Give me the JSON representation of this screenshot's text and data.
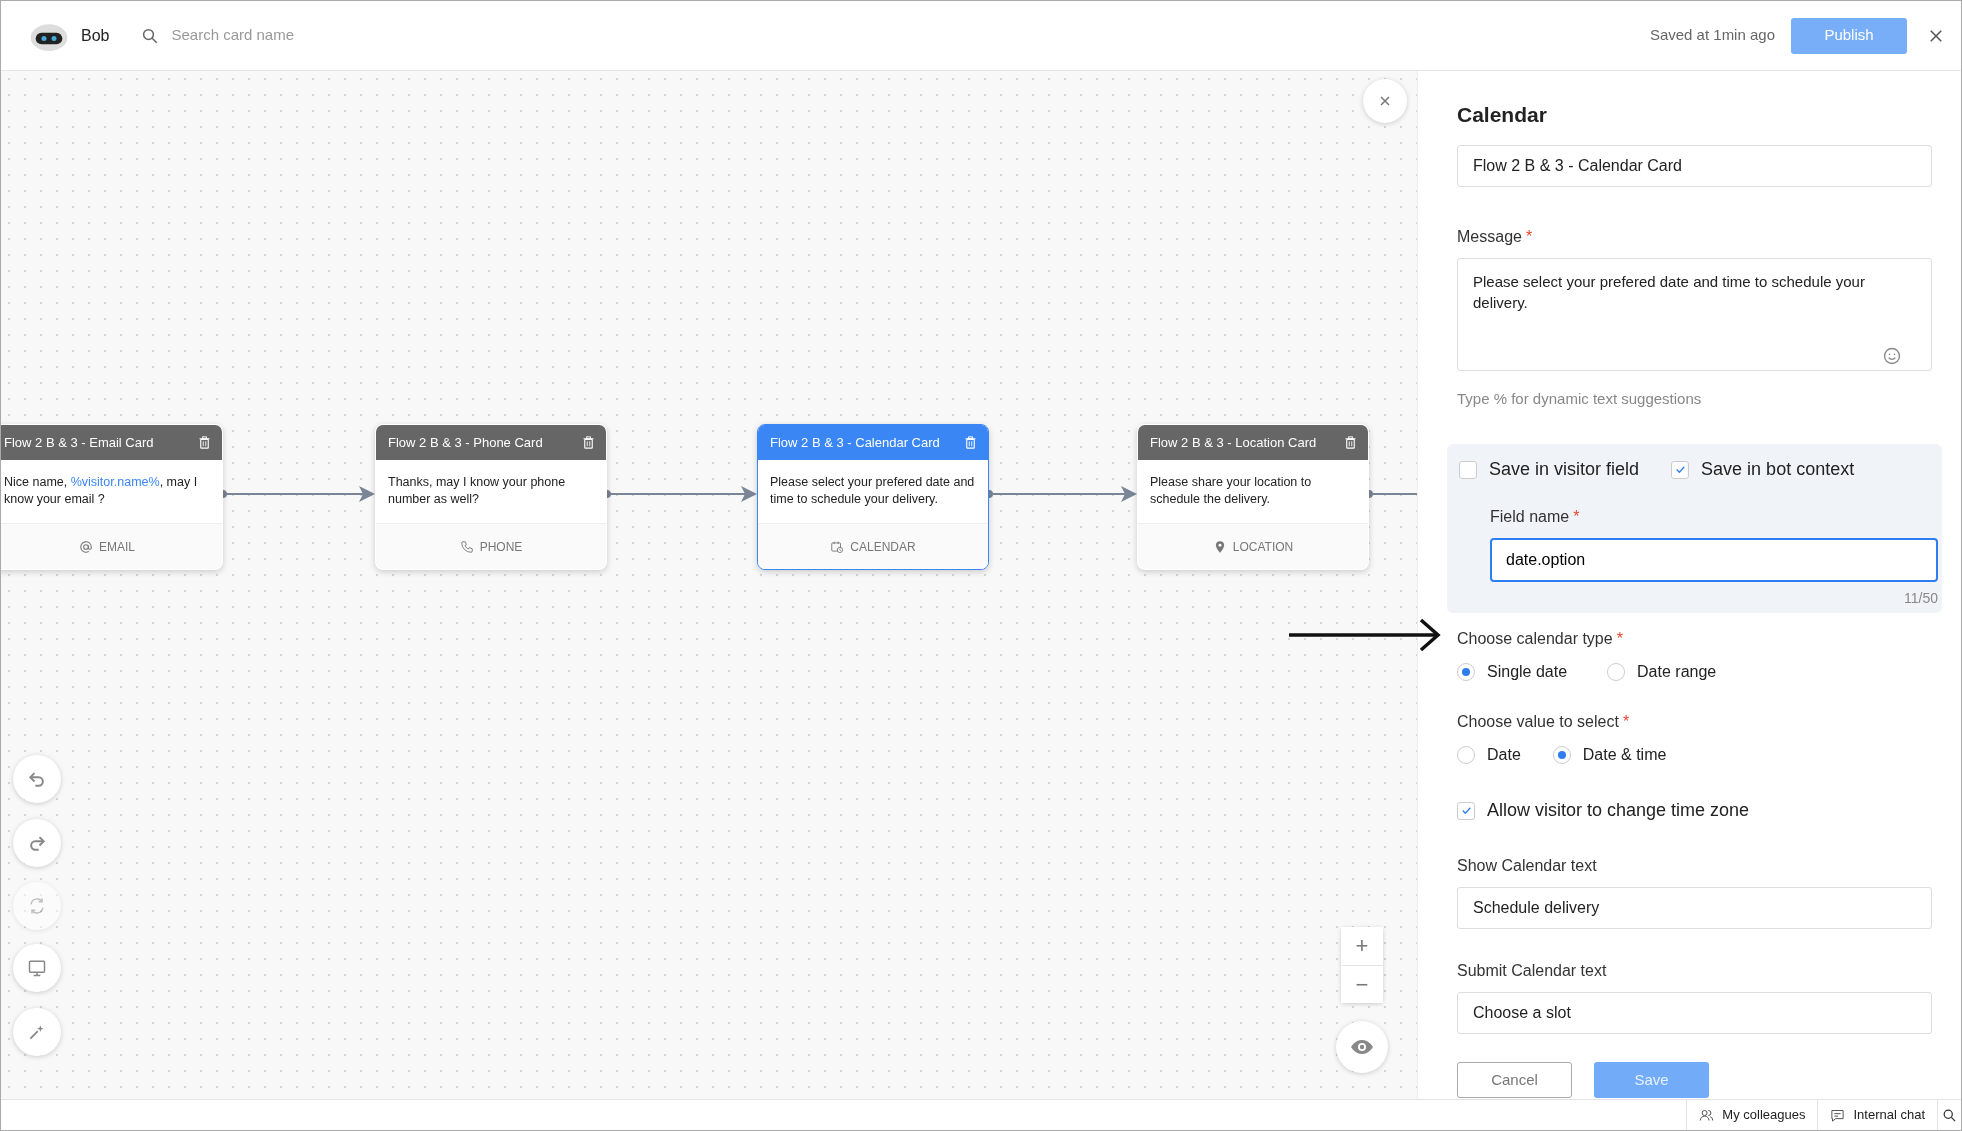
{
  "header": {
    "bot_name": "Bob",
    "search": {
      "placeholder": "Search card name"
    },
    "save_status": "Saved at 1min ago",
    "publish_button": "Publish"
  },
  "cards": [
    {
      "title": "Flow 2 B & 3 - Email Card",
      "kind": "email",
      "selected": false,
      "type_label": "EMAIL",
      "message": [
        {
          "kind": "plain",
          "text": "Nice name, "
        },
        {
          "kind": "variable",
          "text": "%visitor.name%"
        },
        {
          "kind": "plain",
          "text": ", may I know your email ?"
        }
      ]
    },
    {
      "title": "Flow 2 B & 3 - Phone Card",
      "kind": "phone",
      "selected": false,
      "type_label": "PHONE",
      "message": [
        {
          "kind": "plain",
          "text": "Thanks, may I know your phone number as well?"
        }
      ]
    },
    {
      "title": "Flow 2 B & 3 - Calendar Card",
      "kind": "calendar",
      "selected": true,
      "type_label": "CALENDAR",
      "message": [
        {
          "kind": "plain",
          "text": "Please select your prefered date and time to schedule your delivery."
        }
      ]
    },
    {
      "title": "Flow 2 B & 3 - Location Card",
      "kind": "location",
      "selected": false,
      "type_label": "LOCATION",
      "message": [
        {
          "kind": "plain",
          "text": "Please share your location to schedule the delivery."
        }
      ]
    }
  ],
  "canvas_tools": [
    {
      "kind": "undo",
      "disabled": false
    },
    {
      "kind": "redo",
      "disabled": false
    },
    {
      "kind": "refresh",
      "disabled": true
    },
    {
      "kind": "monitor",
      "disabled": false
    },
    {
      "kind": "wand",
      "disabled": false
    }
  ],
  "zoom_controls": {
    "zoom_in": "+",
    "zoom_out": "−"
  },
  "panel": {
    "title": "Calendar",
    "card_name": "Flow 2 B & 3 - Calendar Card",
    "message": {
      "label": "Message",
      "required_mark": "*",
      "value": "Please select your prefered date and time to schedule your delivery.",
      "hint": "Type % for dynamic text suggestions"
    },
    "save_options": [
      {
        "label": "Save in visitor field",
        "checked": false
      },
      {
        "label": "Save in bot context",
        "checked": true
      }
    ],
    "field_name": {
      "label": "Field name",
      "required_mark": "*",
      "value": "date.option",
      "focused": true,
      "counter": "11/50"
    },
    "calendar_type": {
      "label": "Choose calendar type",
      "required_mark": "*",
      "options": [
        {
          "label": "Single date",
          "selected": true
        },
        {
          "label": "Date range",
          "selected": false
        }
      ]
    },
    "value_to_select": {
      "label": "Choose value to select",
      "required_mark": "*",
      "options": [
        {
          "label": "Date",
          "selected": false
        },
        {
          "label": "Date & time",
          "selected": true
        }
      ]
    },
    "allow_timezone": {
      "label": "Allow visitor to change time zone",
      "checked": true
    },
    "show_calendar_text": {
      "label": "Show Calendar text",
      "value": "Schedule delivery"
    },
    "submit_calendar_text": {
      "label": "Submit Calendar text",
      "value": "Choose a slot"
    },
    "buttons": {
      "cancel": "Cancel",
      "save": "Save"
    }
  },
  "status_bar": [
    {
      "kind": "colleagues",
      "label": "My colleagues"
    },
    {
      "kind": "chat",
      "label": "Internal chat"
    },
    {
      "kind": "search"
    }
  ]
}
